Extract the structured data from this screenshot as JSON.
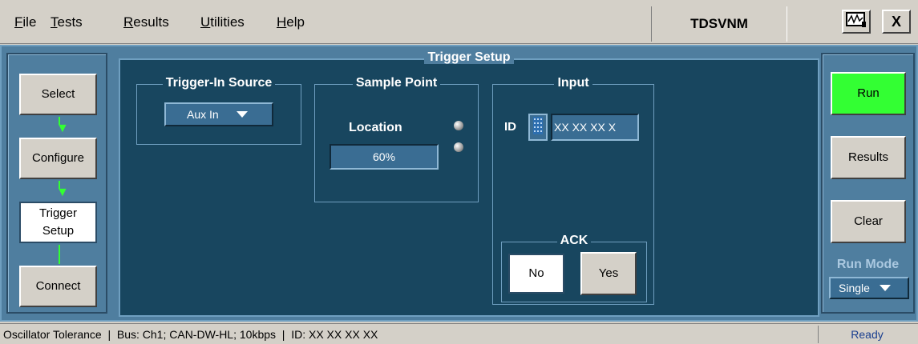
{
  "menu": [
    "File",
    "Tests",
    "Results",
    "Utilities",
    "Help"
  ],
  "app_title": "TDSVNM",
  "window": {
    "close_label": "X"
  },
  "center_title": "Trigger Setup",
  "steps": {
    "select": "Select",
    "configure": "Configure",
    "trigger_setup_line1": "Trigger",
    "trigger_setup_line2": "Setup",
    "connect": "Connect"
  },
  "trigger_in": {
    "label": "Trigger-In Source",
    "value": "Aux In"
  },
  "sample_point": {
    "label": "Sample Point",
    "location_label": "Location",
    "location_value": "60%"
  },
  "input": {
    "label": "Input",
    "id_label": "ID",
    "id_value": "XX XX XX X",
    "ack_label": "ACK",
    "no_label": "No",
    "yes_label": "Yes"
  },
  "right": {
    "run": "Run",
    "results": "Results",
    "clear": "Clear",
    "run_mode_label": "Run Mode",
    "run_mode_value": "Single"
  },
  "status": {
    "text": "Oscillator Tolerance  |  Bus: Ch1; CAN-DW-HL; 10kbps  |  ID: XX XX XX XX",
    "state": "Ready"
  },
  "colors": {
    "run_button": "#33ff33",
    "panel_bg": "#4f7e9f",
    "content_bg": "#18465f",
    "flow_arrow": "#33ff33"
  },
  "icons": {
    "scope_icon": "oscilloscope-icon",
    "close": "close-icon"
  }
}
